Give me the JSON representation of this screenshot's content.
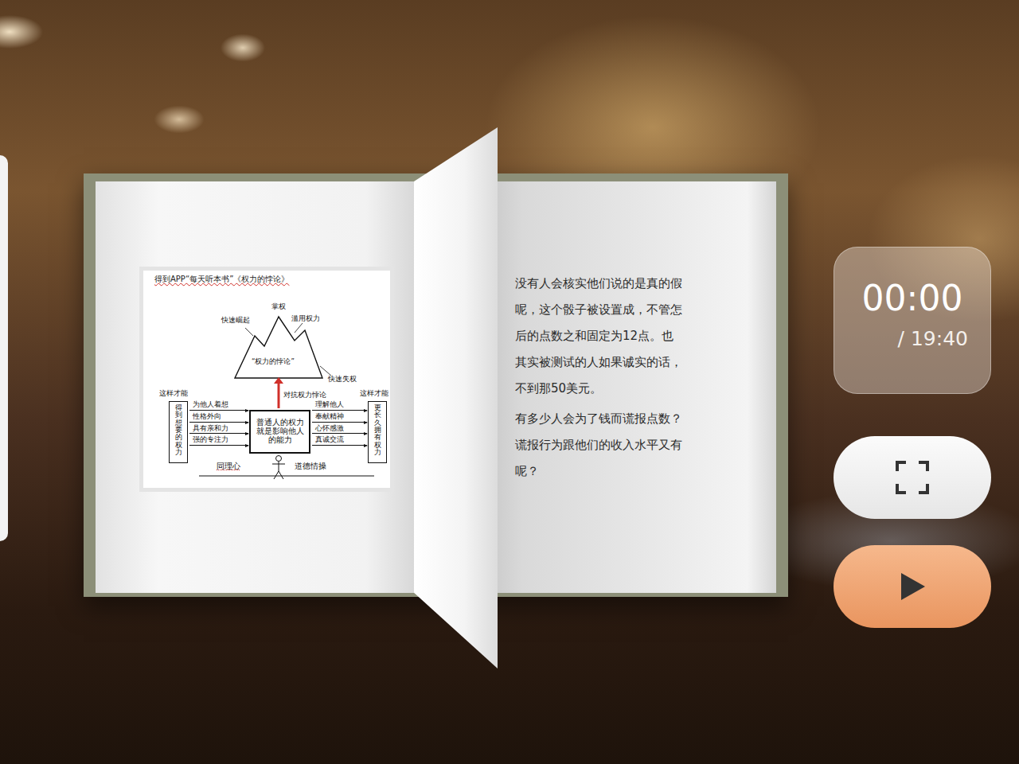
{
  "book": {
    "left_page": {
      "diagram": {
        "title": "得到APP“每天听本书”《权力的悖论》",
        "summit": "掌权",
        "rise": "快速崛起",
        "abuse": "滥用权力",
        "mountain": "“权力的悖论”",
        "fall": "快速失权",
        "counter": "对抗权力悖论",
        "core": "普通人的权力就是影响他人的能力",
        "left_box": {
          "caption": "这样才能",
          "text": "得到想要的权力"
        },
        "right_box": {
          "caption": "这样才能",
          "text": "更长久拥有权力"
        },
        "left_traits": [
          "为他人着想",
          "性格外向",
          "具有亲和力",
          "强的专注力"
        ],
        "right_traits": [
          "理解他人",
          "奉献精神",
          "心怀感激",
          "真诚交流"
        ],
        "foundations": [
          "同理心",
          "道德情操"
        ]
      }
    },
    "right_page": {
      "paragraphs": [
        [
          "没有人会核实他们说的是真的假",
          "呢，这个骰子被设置成，不管怎",
          "后的点数之和固定为12点。也",
          "其实被测试的人如果诚实的话，",
          "不到那50美元。"
        ],
        [
          "有多少人会为了钱而谎报点数？",
          "谎报行为跟他们的收入水平又有",
          "呢？"
        ]
      ]
    }
  },
  "player": {
    "elapsed": "00:00",
    "duration": "/ 19:40",
    "playing": false
  }
}
